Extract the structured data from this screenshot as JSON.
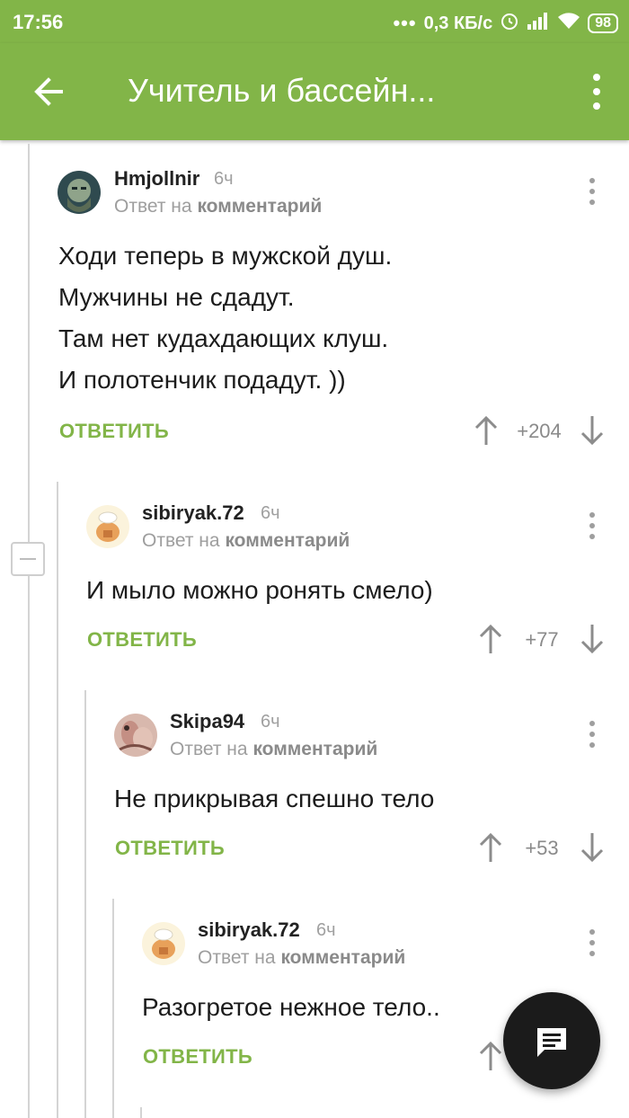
{
  "status_bar": {
    "time": "17:56",
    "network_speed": "0,3 КБ/с",
    "battery": "98"
  },
  "app_bar": {
    "title": "Учитель и бассейн..."
  },
  "comments": [
    {
      "author": "Hmjollnir",
      "age": "6ч",
      "reply_prefix": "Ответ на",
      "reply_target": "комментарий",
      "lines": [
        "Ходи теперь в мужской душ.",
        "Мужчины не сдадут.",
        "Там нет кудахдающих клуш.",
        "И полотенчик подадут. ))"
      ],
      "answer_label": "ОТВЕТИТЬ",
      "score": "+204"
    },
    {
      "author": "sibiryak.72",
      "age": "6ч",
      "reply_prefix": "Ответ на",
      "reply_target": "комментарий",
      "lines": [
        "И мыло можно ронять смело)"
      ],
      "answer_label": "ОТВЕТИТЬ",
      "score": "+77"
    },
    {
      "author": "Skipa94",
      "age": "6ч",
      "reply_prefix": "Ответ на",
      "reply_target": "комментарий",
      "lines": [
        "Не прикрывая спешно тело"
      ],
      "answer_label": "ОТВЕТИТЬ",
      "score": "+53"
    },
    {
      "author": "sibiryak.72",
      "age": "6ч",
      "reply_prefix": "Ответ на",
      "reply_target": "комментарий",
      "lines": [
        "Разогретое нежное тело.."
      ],
      "answer_label": "ОТВЕТИТЬ",
      "score": ""
    }
  ],
  "colors": {
    "accent": "#82b548",
    "fab": "#1b1b1b"
  }
}
